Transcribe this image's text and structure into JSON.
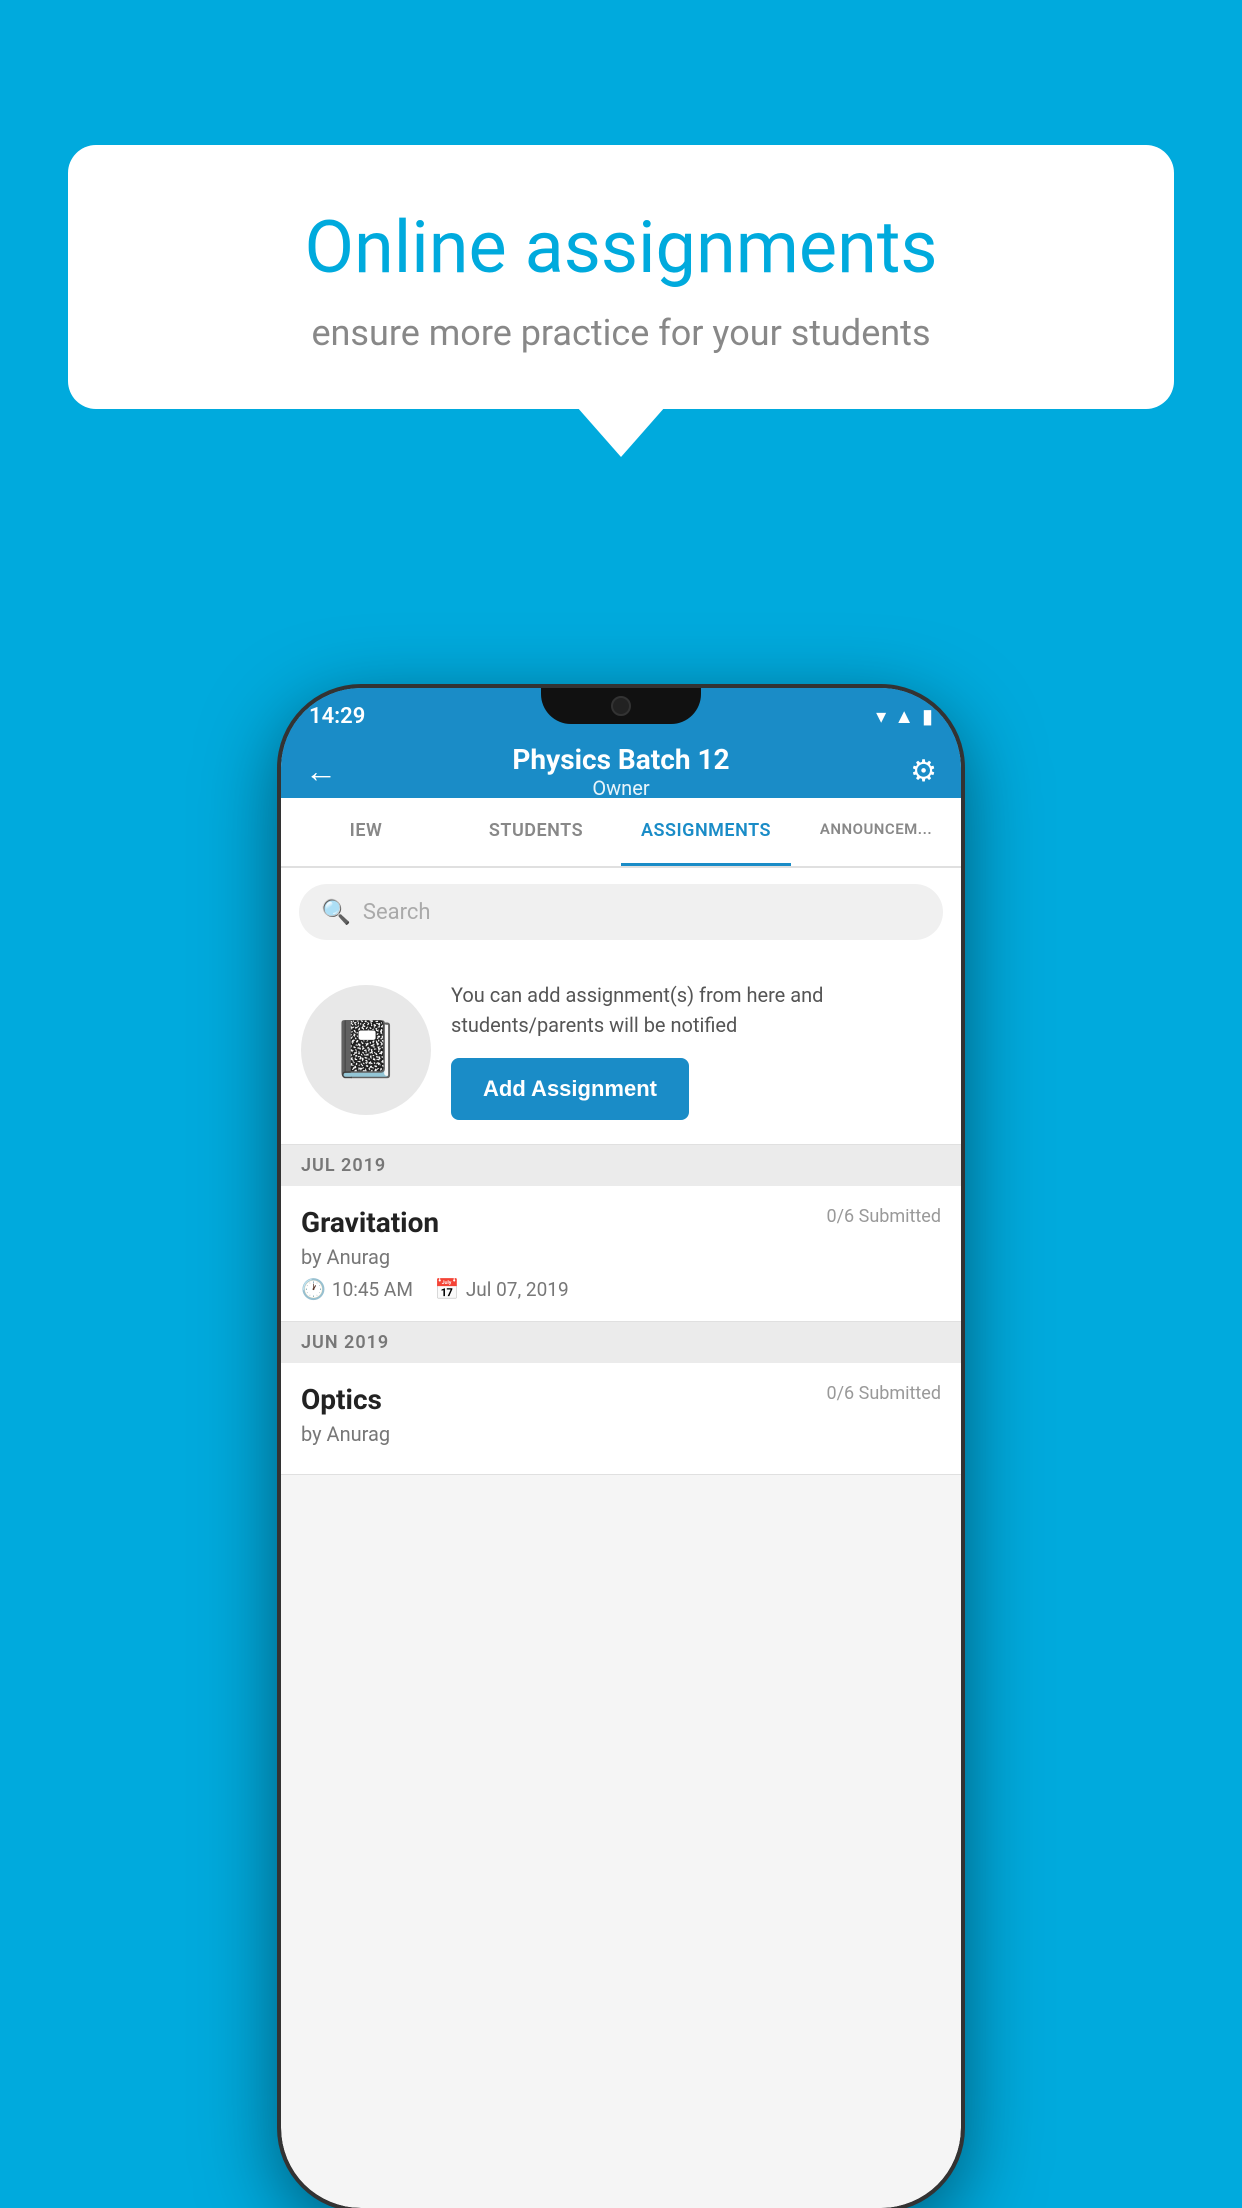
{
  "background_color": "#00AADD",
  "bubble": {
    "title": "Online assignments",
    "subtitle": "ensure more practice for your students"
  },
  "status_bar": {
    "time": "14:29",
    "wifi_icon": "▼",
    "signal_icon": "▲",
    "battery_icon": "▮"
  },
  "app_bar": {
    "title": "Physics Batch 12",
    "subtitle": "Owner",
    "back_icon": "←",
    "settings_icon": "⚙"
  },
  "tabs": [
    {
      "label": "IEW",
      "active": false
    },
    {
      "label": "STUDENTS",
      "active": false
    },
    {
      "label": "ASSIGNMENTS",
      "active": true
    },
    {
      "label": "ANNOUNCEM...",
      "active": false
    }
  ],
  "search": {
    "placeholder": "Search",
    "search_icon": "🔍"
  },
  "add_assignment": {
    "description": "You can add assignment(s) from here and students/parents will be notified",
    "button_label": "Add Assignment"
  },
  "sections": [
    {
      "month_label": "JUL 2019",
      "assignments": [
        {
          "name": "Gravitation",
          "submitted": "0/6 Submitted",
          "author": "by Anurag",
          "time": "10:45 AM",
          "date": "Jul 07, 2019"
        }
      ]
    },
    {
      "month_label": "JUN 2019",
      "assignments": [
        {
          "name": "Optics",
          "submitted": "0/6 Submitted",
          "author": "by Anurag",
          "time": "",
          "date": ""
        }
      ]
    }
  ]
}
